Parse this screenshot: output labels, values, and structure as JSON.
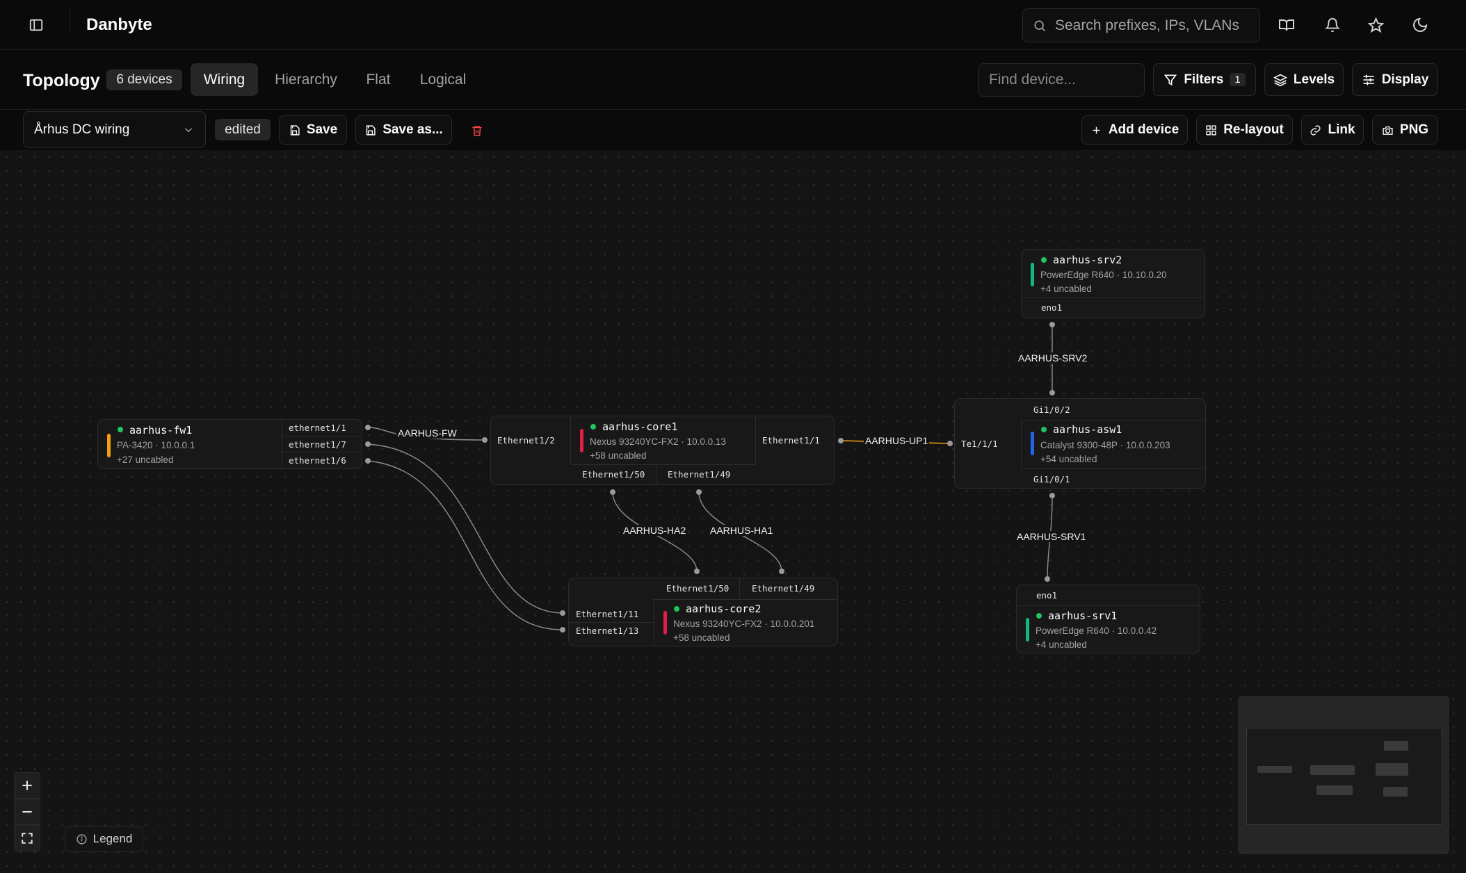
{
  "app": {
    "name": "Danbyte"
  },
  "search": {
    "placeholder": "Search prefixes, IPs, VLANs"
  },
  "header": {
    "icons": [
      "sidebar-toggle-icon",
      "book-icon",
      "bell-icon",
      "star-icon",
      "moon-icon"
    ]
  },
  "topology": {
    "title": "Topology",
    "device_count": "6 devices",
    "tabs": [
      "Wiring",
      "Hierarchy",
      "Flat",
      "Logical"
    ],
    "active_tab": "Wiring",
    "find_placeholder": "Find device...",
    "filters_label": "Filters",
    "filters_count": "1",
    "levels_label": "Levels",
    "display_label": "Display"
  },
  "toolbar": {
    "view_select": "Århus DC wiring",
    "status": "edited",
    "save": "Save",
    "save_as": "Save as...",
    "add_device": "Add device",
    "relayout": "Re-layout",
    "link": "Link",
    "png": "PNG"
  },
  "colors": {
    "accent_green": "#22c55e",
    "fw": "#f59e0b",
    "core": "#e11d48",
    "switch": "#2563eb",
    "server": "#10b981",
    "uplink": "#f59e0b",
    "delete": "#ef4444"
  },
  "devices": {
    "fw1": {
      "name": "aarhus-fw1",
      "sub": "PA-3420 · 10.0.0.1",
      "uncabled": "+27 uncabled",
      "ports": [
        "ethernet1/1",
        "ethernet1/7",
        "ethernet1/6"
      ]
    },
    "core1": {
      "name": "aarhus-core1",
      "sub": "Nexus 93240YC-FX2 · 10.0.0.13",
      "uncabled": "+58 uncabled",
      "port_left": "Ethernet1/2",
      "port_right": "Ethernet1/1",
      "ports_bottom": [
        "Ethernet1/50",
        "Ethernet1/49"
      ]
    },
    "core2": {
      "name": "aarhus-core2",
      "sub": "Nexus 93240YC-FX2 · 10.0.0.201",
      "uncabled": "+58 uncabled",
      "ports_top": [
        "Ethernet1/50",
        "Ethernet1/49"
      ],
      "ports_left": [
        "Ethernet1/11",
        "Ethernet1/13"
      ]
    },
    "asw1": {
      "name": "aarhus-asw1",
      "sub": "Catalyst 9300-48P · 10.0.0.203",
      "uncabled": "+54 uncabled",
      "port_top": "Gi1/0/2",
      "port_left": "Te1/1/1",
      "port_bottom": "Gi1/0/1"
    },
    "srv2": {
      "name": "aarhus-srv2",
      "sub": "PowerEdge R640 · 10.10.0.20",
      "uncabled": "+4 uncabled",
      "port": "eno1"
    },
    "srv1": {
      "name": "aarhus-srv1",
      "sub": "PowerEdge R640 · 10.0.0.42",
      "uncabled": "+4 uncabled",
      "port": "eno1"
    }
  },
  "links": {
    "fw": "AARHUS-FW",
    "up1": "AARHUS-UP1",
    "ha2": "AARHUS-HA2",
    "ha1": "AARHUS-HA1",
    "srv2": "AARHUS-SRV2",
    "srv1": "AARHUS-SRV1"
  },
  "legend": {
    "label": "Legend"
  }
}
